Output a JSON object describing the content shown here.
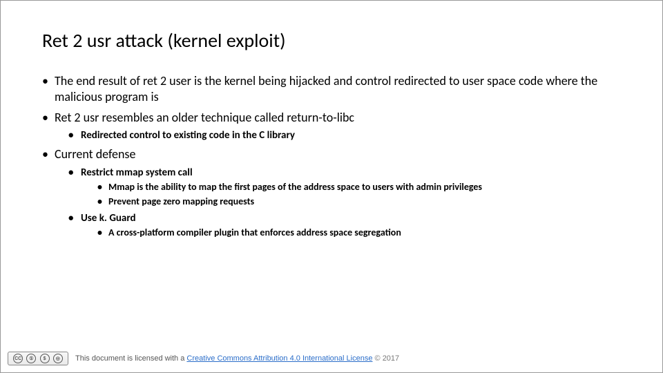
{
  "title": "Ret 2 usr attack (kernel exploit)",
  "bullets": {
    "b1": "The end result of ret 2 user is the kernel being hijacked and control redirected to user space code where the malicious program is",
    "b2": "Ret 2 usr resembles an older technique called return-to-libc",
    "b2_1": "Redirected control to existing code in the C library",
    "b3": "Current defense",
    "b3_1": "Restrict mmap system call",
    "b3_1_1": "Mmap is the ability to map the first pages of the address space to users with admin privileges",
    "b3_1_2": "Prevent page zero mapping requests",
    "b3_2": "Use k. Guard",
    "b3_2_1": "A cross-platform compiler plugin that enforces address space segregation"
  },
  "footer": {
    "prefix": "This document is licensed with a ",
    "link": "Creative Commons Attribution 4.0 International License",
    "copyright": "© 2017"
  },
  "cc": {
    "c1": "CC",
    "c2": "①",
    "c3": "$",
    "c4": "◎",
    "sub": "BY   NC   SA"
  }
}
